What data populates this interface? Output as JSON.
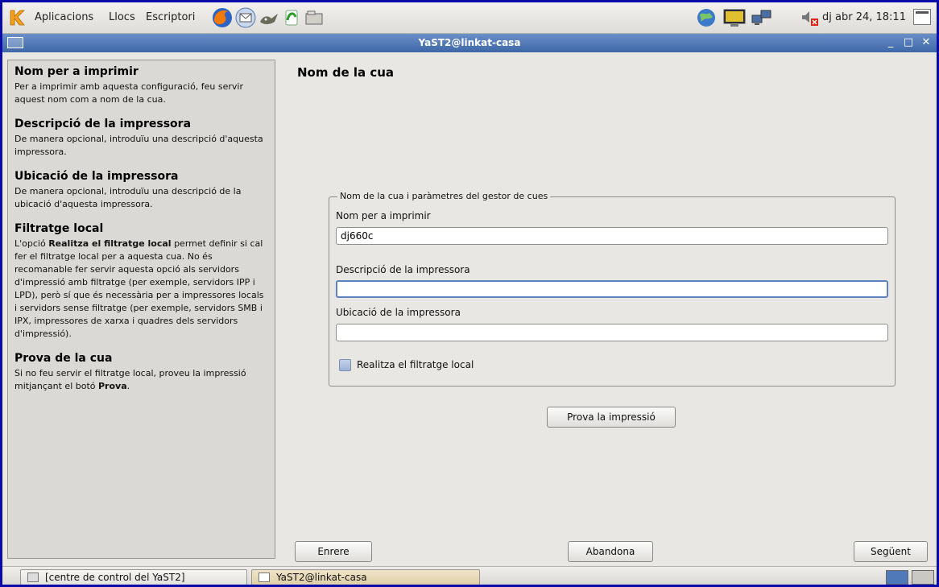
{
  "top_panel": {
    "menus": [
      "Aplicacions",
      "Llocs",
      "Escriptori"
    ],
    "clock": "dj abr 24, 18:11"
  },
  "window": {
    "title": "YaST2@linkat-casa",
    "minimize_symbol": "_",
    "maximize_symbol": "□",
    "close_symbol": "✕"
  },
  "help": {
    "sections": [
      {
        "title": "Nom per a imprimir",
        "body": "Per a imprimir amb aquesta configuració, feu servir aquest nom com a nom de la cua."
      },
      {
        "title": "Descripció de la impressora",
        "body": "De manera opcional, introduïu una descripció d'aquesta impressora."
      },
      {
        "title": "Ubicació de la impressora",
        "body": "De manera opcional, introduïu una descripció de la ubicació d'aquesta impressora."
      },
      {
        "title": "Filtratge local",
        "body_pre": "L'opció ",
        "body_bold": "Realitza el filtratge local",
        "body_post": " permet definir si cal fer el filtratge local per a aquesta cua. No és recomanable fer servir aquesta opció als servidors d'impressió amb filtratge (per exemple, servidors IPP i LPD), però sí que és necessària per a impressores locals i servidors sense filtratge (per exemple, servidors SMB i IPX, impressores de xarxa i quadres dels servidors d'impressió)."
      },
      {
        "title": "Prova de la cua",
        "body_pre": "Si no feu servir el filtratge local, proveu la impressió mitjançant el botó ",
        "body_bold": "Prova",
        "body_post": "."
      }
    ]
  },
  "main": {
    "title": "Nom de la cua",
    "group_title": "Nom de la cua i paràmetres del gestor de cues",
    "fields": {
      "queue_name": {
        "label": "Nom per a imprimir",
        "value": "dj660c"
      },
      "description": {
        "label": "Descripció de la impressora",
        "value": ""
      },
      "location": {
        "label": "Ubicació de la impressora",
        "value": ""
      }
    },
    "local_filter": {
      "label": "Realitza el filtratge local",
      "checked": false
    },
    "test_button": "Prova la impressió"
  },
  "nav": {
    "back": "Enrere",
    "abort": "Abandona",
    "next": "Següent"
  },
  "taskbar": {
    "tasks": [
      "[centre de control del YaST2]",
      "YaST2@linkat-casa"
    ]
  },
  "colors": {
    "titlebar": "#4f79b8",
    "accent": "#5c82c0",
    "screen_border": "#0a0aa8"
  }
}
